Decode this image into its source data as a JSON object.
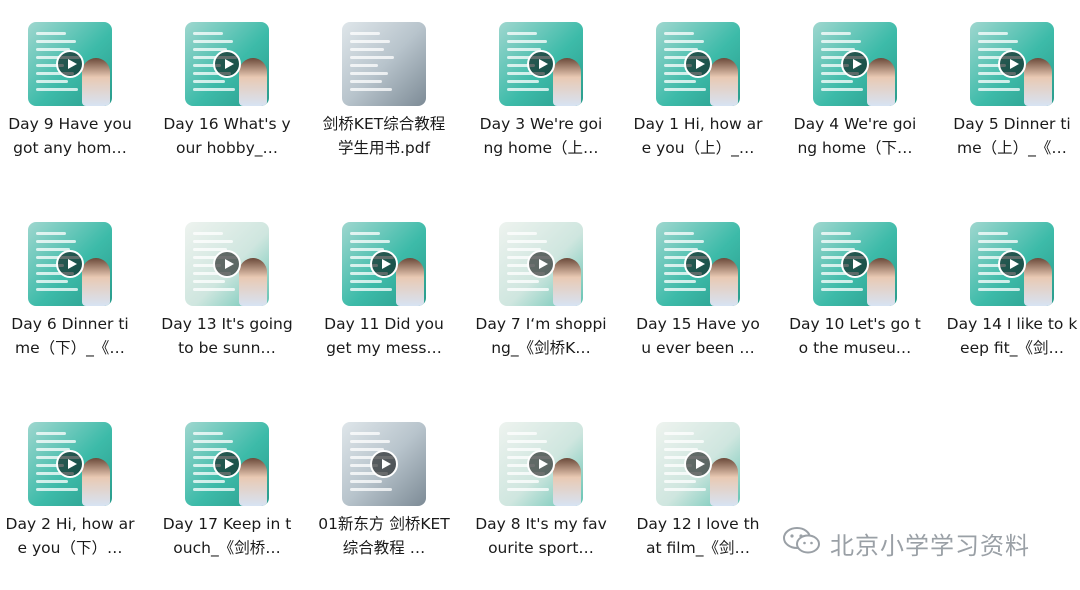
{
  "files": [
    {
      "name": "Day 9 Have you got any hom…",
      "type": "video",
      "thumb": "teal"
    },
    {
      "name": "Day 16 What's your hobby_…",
      "type": "video",
      "thumb": "teal"
    },
    {
      "name": "剑桥KET综合教程学生用书.pdf",
      "type": "pdf",
      "thumb": "book"
    },
    {
      "name": "Day 3 We're going home（上…",
      "type": "video",
      "thumb": "teal"
    },
    {
      "name": "Day 1 Hi, how are you（上）_…",
      "type": "video",
      "thumb": "teal"
    },
    {
      "name": "Day 4 We're going home（下…",
      "type": "video",
      "thumb": "teal"
    },
    {
      "name": "Day 5 Dinner time（上）_《…",
      "type": "video",
      "thumb": "teal"
    },
    {
      "name": "Day 6 Dinner time（下）_《…",
      "type": "video",
      "thumb": "teal"
    },
    {
      "name": "Day 13 It's going to be sunn…",
      "type": "video",
      "thumb": "sheet"
    },
    {
      "name": "Day 11 Did you get my mess…",
      "type": "video",
      "thumb": "teal"
    },
    {
      "name": "Day 7 I‘m shopping_《剑桥K…",
      "type": "video",
      "thumb": "sheet"
    },
    {
      "name": "Day 15 Have you ever been …",
      "type": "video",
      "thumb": "teal"
    },
    {
      "name": "Day 10 Let's go to the museu…",
      "type": "video",
      "thumb": "teal"
    },
    {
      "name": "Day 14 I like to keep fit_《剑…",
      "type": "video",
      "thumb": "teal"
    },
    {
      "name": "Day 2 Hi, how are you（下）…",
      "type": "video",
      "thumb": "teal"
    },
    {
      "name": "Day 17 Keep in touch_《剑桥…",
      "type": "video",
      "thumb": "teal"
    },
    {
      "name": "01新东方 剑桥KET综合教程 …",
      "type": "video",
      "thumb": "book"
    },
    {
      "name": "Day 8 It's my favourite sport…",
      "type": "video",
      "thumb": "sheet"
    },
    {
      "name": "Day 12 I love that film_《剑…",
      "type": "video",
      "thumb": "sheet"
    }
  ],
  "watermark": {
    "text": "北京小学学习资料",
    "icon": "wechat-icon",
    "color": "#9aa0a6"
  },
  "colors": {
    "accent": "#3dbba9"
  }
}
